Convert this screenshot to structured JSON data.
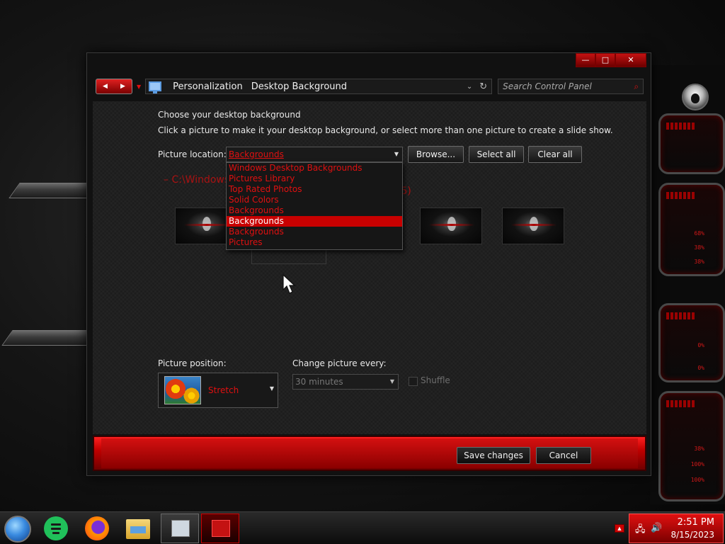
{
  "window": {
    "caption_buttons": {
      "minimize": "—",
      "maximize": "□",
      "close": "✕"
    }
  },
  "navigation": {
    "back_icon": "◀",
    "forward_icon": "▶",
    "recent_icon": "▼",
    "breadcrumbs": [
      "Personalization",
      "Desktop Background"
    ],
    "address_dropdown": "⌄",
    "refresh_icon": "↻",
    "search_placeholder": "Search Control Panel",
    "search_icon": "⌕"
  },
  "content": {
    "heading": "Choose your desktop background",
    "subtext": "Click a picture to make it your desktop background, or select more than one picture to create a slide show.",
    "picture_location_label": "Picture location:",
    "picture_location_value": "Backgrounds",
    "browse_label": "Browse...",
    "select_all_label": "Select all",
    "clear_all_label": "Clear all",
    "folder_path": "C:\\Windows",
    "folder_path_tail": "s (5)",
    "dropdown_options": [
      "Windows Desktop Backgrounds",
      "Pictures Library",
      "Top Rated Photos",
      "Solid Colors",
      "Backgrounds",
      "Backgrounds",
      "Backgrounds",
      "Pictures"
    ],
    "dropdown_selected_index": 5,
    "picture_position_label": "Picture position:",
    "picture_position_value": "Stretch",
    "change_every_label": "Change picture every:",
    "change_every_value": "30 minutes",
    "shuffle_label": "Shuffle",
    "shuffle_checked": false
  },
  "footer": {
    "save_label": "Save changes",
    "cancel_label": "Cancel"
  },
  "taskbar": {
    "time": "2:51 PM",
    "date": "8/15/2023",
    "tray_arrow": "▲",
    "network_icon": "🖧",
    "volume_icon": "🔊"
  },
  "desktop": {
    "gauge_values": [
      "68%",
      "38%",
      "38%",
      "0%",
      "0%",
      "38%",
      "100%",
      "100%"
    ]
  },
  "colors": {
    "accent": "#c80000",
    "text_red": "#e01010"
  }
}
